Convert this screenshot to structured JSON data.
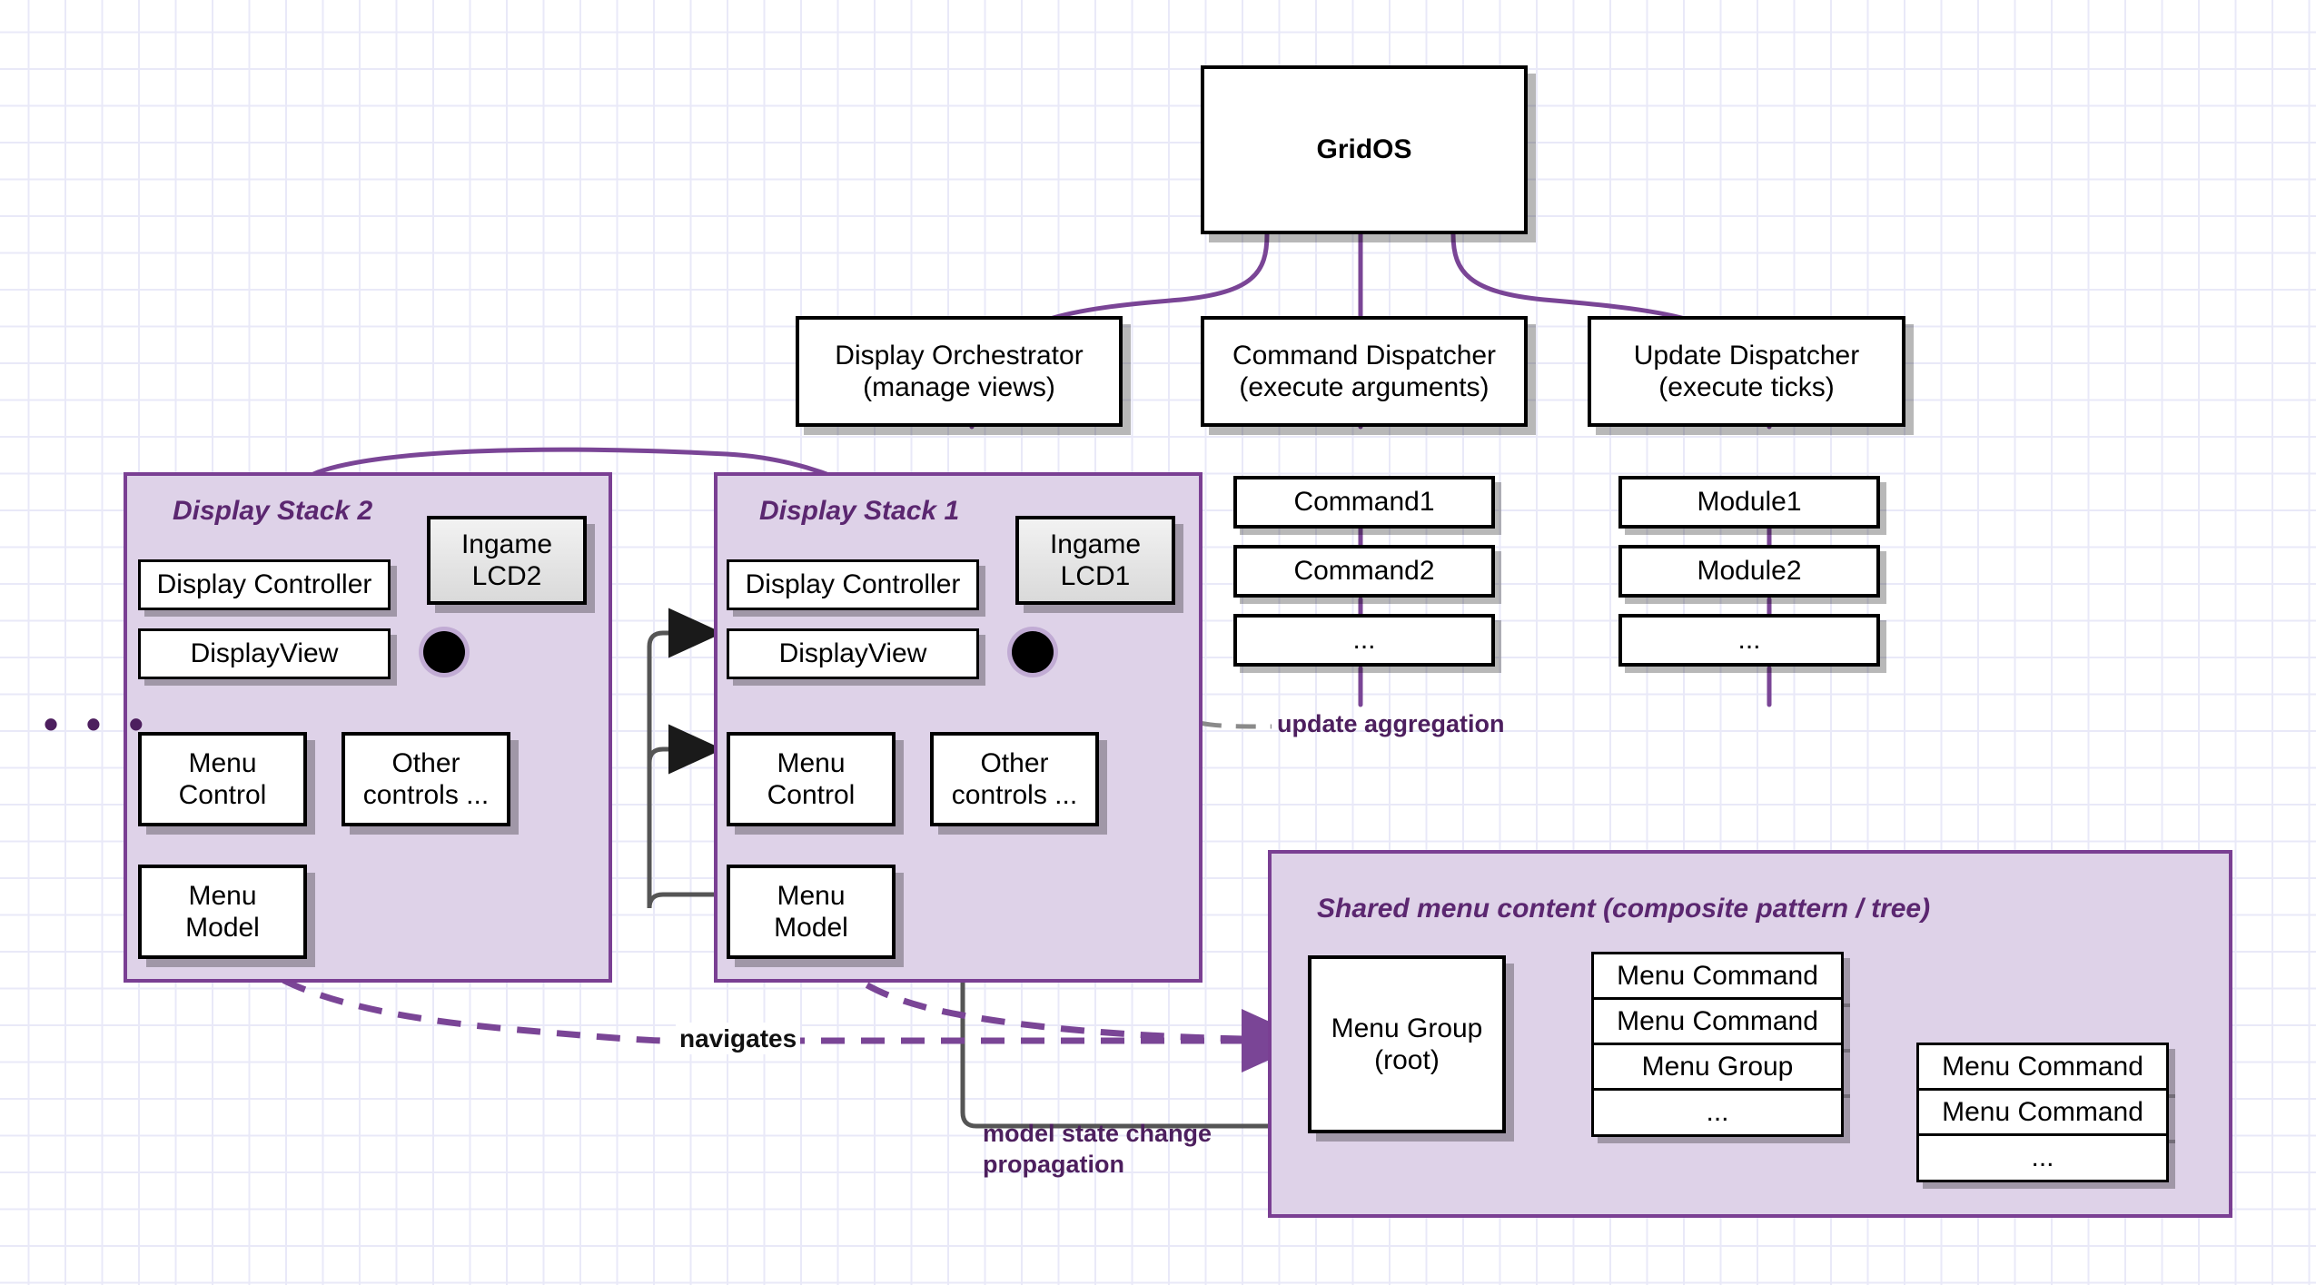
{
  "diagram": {
    "title_node": {
      "label": "GridOS"
    },
    "dispatchers": [
      {
        "name": "display-orchestrator",
        "line1": "Display Orchestrator",
        "line2": "(manage views)"
      },
      {
        "name": "command-dispatcher",
        "line1": "Command Dispatcher",
        "line2": "(execute arguments)"
      },
      {
        "name": "update-dispatcher",
        "line1": "Update Dispatcher",
        "line2": "(execute ticks)"
      }
    ],
    "command_list": [
      "Command1",
      "Command2",
      "..."
    ],
    "module_list": [
      "Module1",
      "Module2",
      "..."
    ],
    "stacks": [
      {
        "name": "display-stack-2",
        "title": "Display Stack 2",
        "controller": "Display Controller",
        "view": "DisplayView",
        "menu_control": "Menu\nControl",
        "other_controls": "Other\ncontrols ...",
        "menu_model": "Menu\nModel",
        "lcd": "Ingame\nLCD2"
      },
      {
        "name": "display-stack-1",
        "title": "Display Stack 1",
        "controller": "Display Controller",
        "view": "DisplayView",
        "menu_control": "Menu\nControl",
        "other_controls": "Other\ncontrols ...",
        "menu_model": "Menu\nModel",
        "lcd": "Ingame\nLCD1"
      }
    ],
    "shared_menu": {
      "title": "Shared menu content (composite pattern / tree)",
      "root": "Menu Group\n(root)",
      "level1": [
        "Menu Command",
        "Menu Command",
        "Menu Group",
        "..."
      ],
      "level2": [
        "Menu Command",
        "Menu Command",
        "..."
      ]
    },
    "edge_labels": {
      "update_aggregation": "update aggregation",
      "navigates": "navigates",
      "model_state_change": "model state change\npropagation"
    },
    "more_stacks_ellipsis": "• • •",
    "colors": {
      "group_fill": "#ded2e8",
      "group_border": "#7a3f93",
      "wire_purple": "#7a4596",
      "wire_gray": "#6d6d6d",
      "label_purple": "#4d1f5e",
      "grid_line": "#e9e9f8"
    }
  }
}
